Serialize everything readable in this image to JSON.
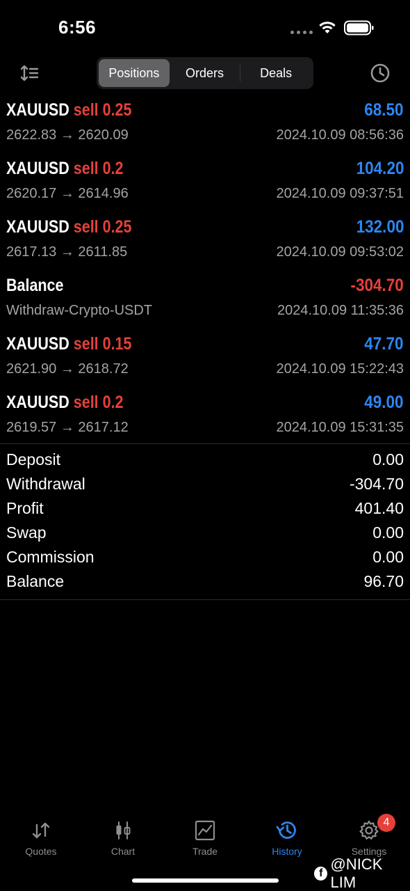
{
  "status_bar": {
    "time": "6:56"
  },
  "toolbar": {
    "tabs": [
      {
        "label": "Positions",
        "active": true
      },
      {
        "label": "Orders",
        "active": false
      },
      {
        "label": "Deals",
        "active": false
      }
    ],
    "left_icon": "sort-icon",
    "right_icon": "history-clock-icon"
  },
  "deals": [
    {
      "symbol": "XAUUSD",
      "type": "sell 0.25",
      "profit": "68.50",
      "sub": "2622.83 → 2620.09",
      "time": "2024.10.09 08:56:36"
    },
    {
      "symbol": "XAUUSD",
      "type": "sell 0.2",
      "profit": "104.20",
      "sub": "2620.17 → 2614.96",
      "time": "2024.10.09 09:37:51"
    },
    {
      "symbol": "XAUUSD",
      "type": "sell 0.25",
      "profit": "132.00",
      "sub": "2617.13 → 2611.85",
      "time": "2024.10.09 09:53:02"
    },
    {
      "symbol": "Balance",
      "type": "",
      "profit": "-304.70",
      "sub": "Withdraw-Crypto-USDT",
      "time": "2024.10.09 11:35:36"
    },
    {
      "symbol": "XAUUSD",
      "type": "sell 0.15",
      "profit": "47.70",
      "sub": "2621.90 → 2618.72",
      "time": "2024.10.09 15:22:43"
    },
    {
      "symbol": "XAUUSD",
      "type": "sell 0.2",
      "profit": "49.00",
      "sub": "2619.57 → 2617.12",
      "time": "2024.10.09 15:31:35"
    }
  ],
  "summary": [
    {
      "label": "Deposit",
      "value": "0.00"
    },
    {
      "label": "Withdrawal",
      "value": "-304.70"
    },
    {
      "label": "Profit",
      "value": "401.40"
    },
    {
      "label": "Swap",
      "value": "0.00"
    },
    {
      "label": "Commission",
      "value": "0.00"
    },
    {
      "label": "Balance",
      "value": "96.70"
    }
  ],
  "tab_bar": [
    {
      "label": "Quotes",
      "icon": "quotes-icon",
      "active": false
    },
    {
      "label": "Chart",
      "icon": "chart-icon",
      "active": false
    },
    {
      "label": "Trade",
      "icon": "trade-icon",
      "active": false
    },
    {
      "label": "History",
      "icon": "history-icon",
      "active": true
    },
    {
      "label": "Settings",
      "icon": "settings-icon",
      "active": false,
      "badge": "4"
    }
  ],
  "watermark": "@NICK LIM",
  "colors": {
    "profit_positive": "#2d86f0",
    "negative": "#e5413a",
    "accent": "#2d86f0",
    "muted": "#a4a4a8"
  }
}
